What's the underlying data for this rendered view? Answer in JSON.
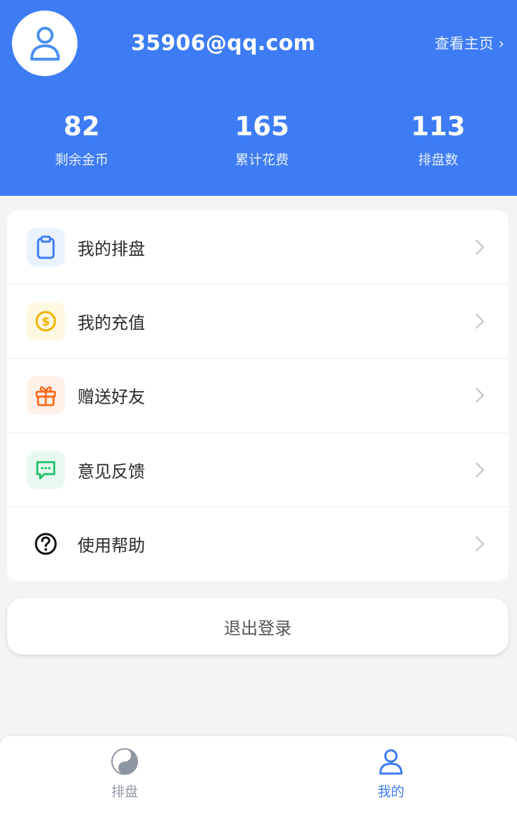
{
  "header": {
    "email": "35906@qq.com",
    "home_link": "查看主页 ›",
    "stats": [
      {
        "value": "82",
        "label": "剩余金币"
      },
      {
        "value": "165",
        "label": "累计花费"
      },
      {
        "value": "113",
        "label": "排盘数"
      }
    ],
    "bg_color": "#3d7cf4"
  },
  "menu": {
    "items": [
      {
        "label": "我的排盘",
        "icon": "clipboard-icon",
        "icon_bg": "#eaf2ff",
        "icon_color": "#3d7cf4"
      },
      {
        "label": "我的充值",
        "icon": "coin-icon",
        "icon_bg": "#fff8e1",
        "icon_color": "#f0b400"
      },
      {
        "label": "赠送好友",
        "icon": "gift-icon",
        "icon_bg": "#fff1e8",
        "icon_color": "#ff6a1a"
      },
      {
        "label": "意见反馈",
        "icon": "message-icon",
        "icon_bg": "#e9f9ef",
        "icon_color": "#19c26a"
      },
      {
        "label": "使用帮助",
        "icon": "help-icon",
        "icon_bg": "#ffffff",
        "icon_color": "#111111"
      }
    ]
  },
  "logout_label": "退出登录",
  "tabbar": {
    "tabs": [
      {
        "label": "排盘",
        "icon": "yin-yang-icon",
        "active": false
      },
      {
        "label": "我的",
        "icon": "user-icon",
        "active": true
      }
    ],
    "active_color": "#3d7cf4",
    "inactive_color": "#8f96a3"
  }
}
